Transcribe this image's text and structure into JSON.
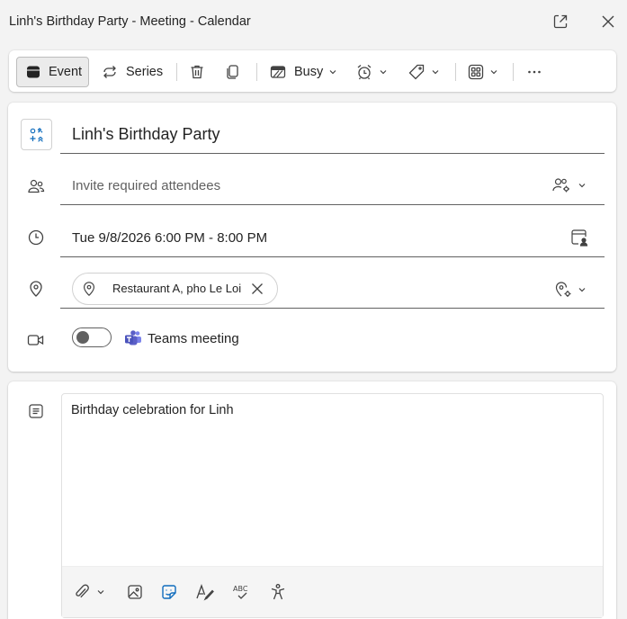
{
  "window": {
    "title": "Linh's Birthday Party - Meeting - Calendar"
  },
  "toolbar": {
    "event_label": "Event",
    "series_label": "Series",
    "busy_label": "Busy"
  },
  "form": {
    "title_value": "Linh's Birthday Party",
    "attendees_placeholder": "Invite required attendees",
    "datetime": "Tue 9/8/2026 6:00 PM - 8:00 PM",
    "location_chip": "Restaurant A, pho Le Loi",
    "teams_label": "Teams meeting",
    "teams_toggle_on": false
  },
  "body": {
    "text": "Birthday celebration for Linh"
  },
  "colors": {
    "accent": "#0f6cbd",
    "teams_purple": "#5b5fc7",
    "icon": "#424242"
  }
}
